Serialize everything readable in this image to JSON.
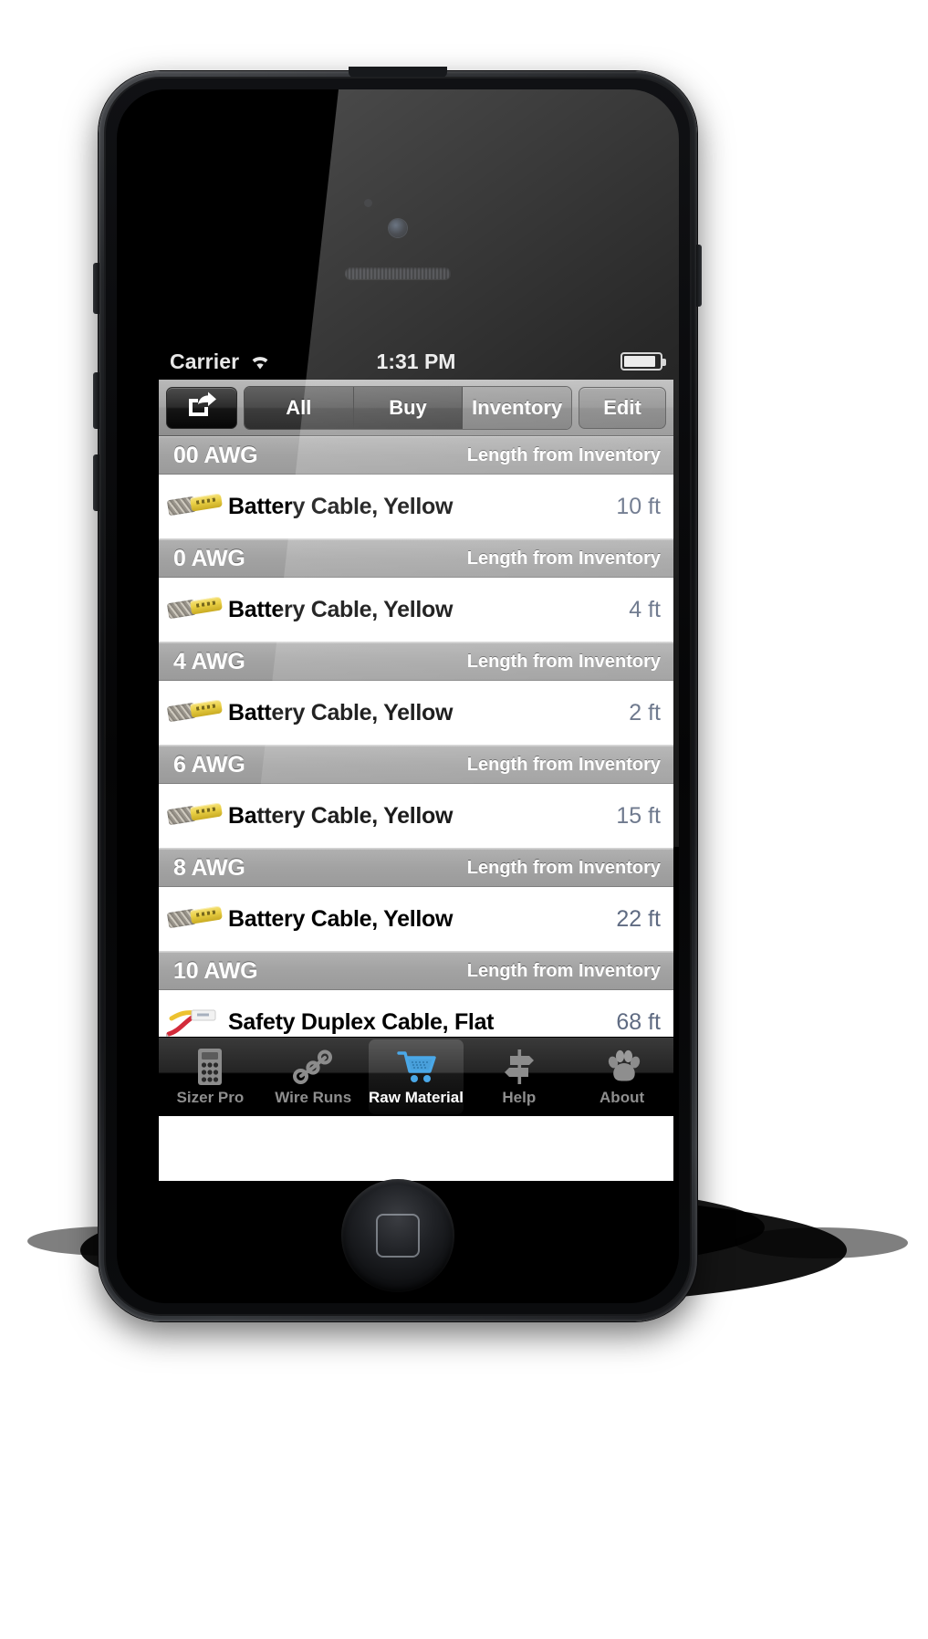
{
  "status_bar": {
    "carrier": "Carrier",
    "wifi_icon": "wifi-icon",
    "time": "1:31 PM",
    "battery_icon": "battery-icon"
  },
  "toolbar": {
    "share_button_icon": "share-icon",
    "segments": [
      {
        "label": "All",
        "selected": false
      },
      {
        "label": "Buy",
        "selected": false
      },
      {
        "label": "Inventory",
        "selected": true
      }
    ],
    "edit_label": "Edit"
  },
  "list": {
    "sections": [
      {
        "gauge": "00 AWG",
        "right_header": "Length from Inventory",
        "rows": [
          {
            "thumb": "battery-cable-yellow-thumb",
            "title": "Battery Cable, Yellow",
            "value": "10 ft"
          }
        ]
      },
      {
        "gauge": "0 AWG",
        "right_header": "Length from Inventory",
        "rows": [
          {
            "thumb": "battery-cable-yellow-thumb",
            "title": "Battery Cable, Yellow",
            "value": "4 ft"
          }
        ]
      },
      {
        "gauge": "4 AWG",
        "right_header": "Length from Inventory",
        "rows": [
          {
            "thumb": "battery-cable-yellow-thumb",
            "title": "Battery Cable, Yellow",
            "value": "2 ft"
          }
        ]
      },
      {
        "gauge": "6 AWG",
        "right_header": "Length from Inventory",
        "rows": [
          {
            "thumb": "battery-cable-yellow-thumb",
            "title": "Battery Cable, Yellow",
            "value": "15 ft"
          }
        ]
      },
      {
        "gauge": "8 AWG",
        "right_header": "Length from Inventory",
        "rows": [
          {
            "thumb": "battery-cable-yellow-thumb",
            "title": "Battery Cable, Yellow",
            "value": "22 ft"
          }
        ]
      },
      {
        "gauge": "10 AWG",
        "right_header": "Length from Inventory",
        "rows": [
          {
            "thumb": "safety-duplex-cable-flat-thumb",
            "title": "Safety Duplex Cable, Flat",
            "value": "68 ft"
          }
        ]
      }
    ]
  },
  "tab_bar": {
    "tabs": [
      {
        "label": "Sizer Pro",
        "icon": "calculator-icon",
        "selected": false
      },
      {
        "label": "Wire Runs",
        "icon": "wire-runs-icon",
        "selected": false
      },
      {
        "label": "Raw Material",
        "icon": "shopping-cart-icon",
        "selected": true
      },
      {
        "label": "Help",
        "icon": "signpost-icon",
        "selected": false
      },
      {
        "label": "About",
        "icon": "paw-print-icon",
        "selected": false
      }
    ]
  },
  "colors": {
    "accent_value": "#5f6b82",
    "cart_blue": "#4aa8e8",
    "section_header": "#a2a2a2",
    "toolbar": "#9a9a9a"
  }
}
